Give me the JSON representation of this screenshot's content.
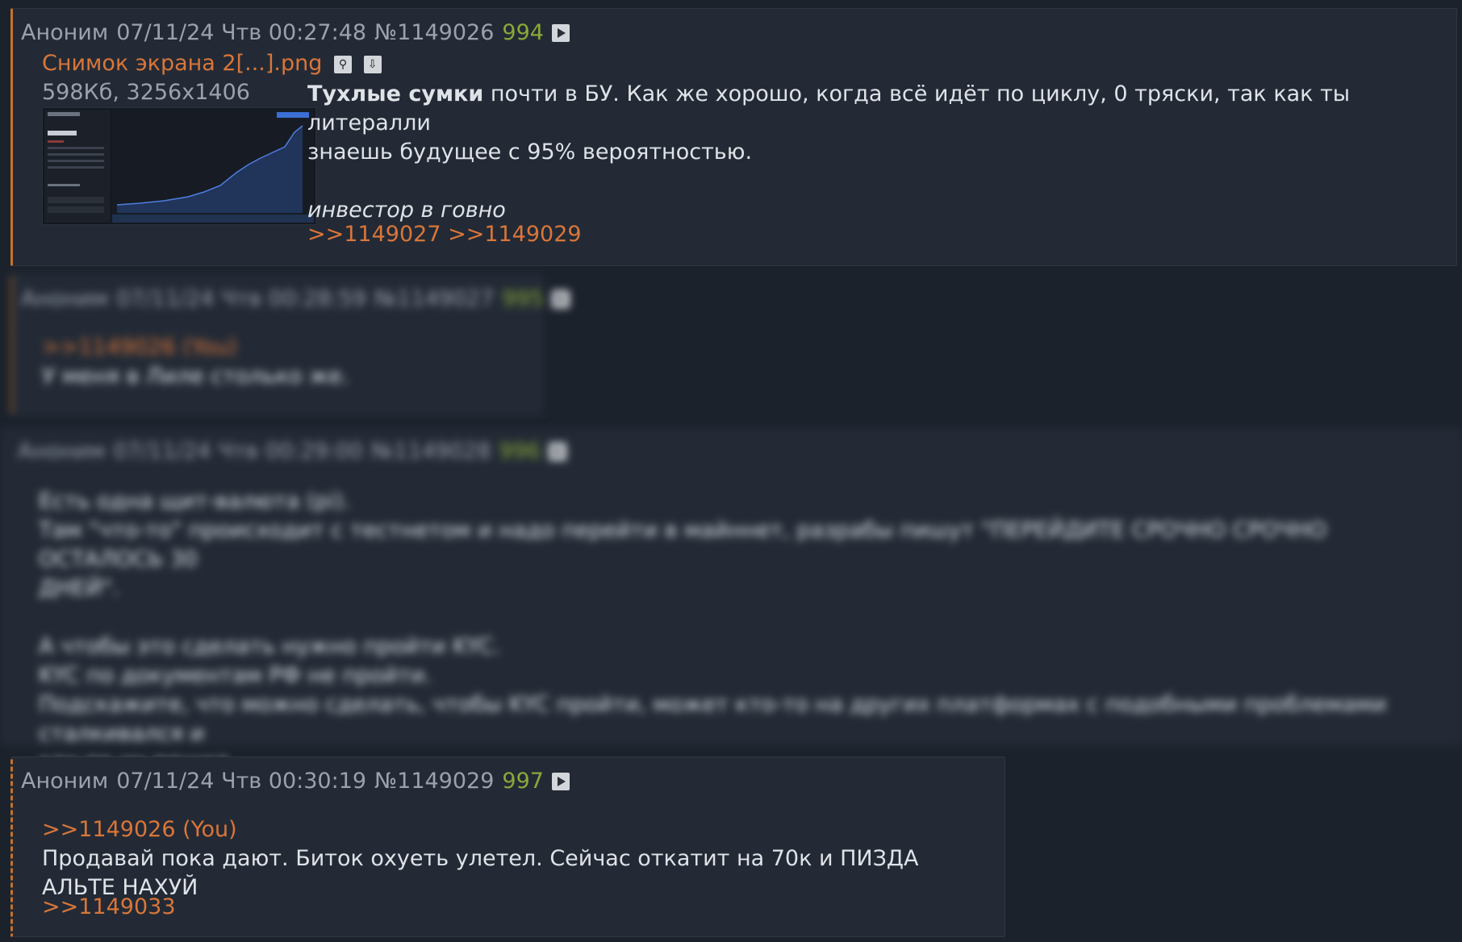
{
  "posts": [
    {
      "author": "Аноним",
      "date": "07/11/24 Чтв 00:27:48",
      "number": "№1149026",
      "count": "994",
      "file": {
        "name": "Снимок экрана 2[...].png",
        "meta": "598Кб, 3256x1406"
      },
      "text_bold": "Тухлые сумки",
      "text_rest": " почти в БУ. Как же хорошо, когда всё идёт по циклу, 0 тряски, так как ты литералли",
      "text_line2": "знаешь будущее с 95% вероятностью.",
      "italic": "инвестор в говно",
      "replies": ">>1149027 >>1149029"
    },
    {
      "author": "Аноним",
      "date": "07/11/24 Чтв 00:28:59",
      "number": "№1149027",
      "count": "995",
      "quote": ">>1149026 (You)",
      "text": "У меня в Лиле столько же."
    },
    {
      "author": "Аноним",
      "date": "07/11/24 Чтв 00:29:00",
      "number": "№1149028",
      "count": "996",
      "lines": [
        "Есть одна щит-валюта (pi).",
        "Там \"что-то\" происходит с тестнетом и надо перейти в майннет, разрабы пишут \"ПЕРЕЙДИТЕ СРОЧНО СРОЧНО ОСТАЛОСЬ 30",
        "ДНЕЙ\".",
        "",
        "А чтобы это сделать нужно пройти KYC.",
        "KYC по документам РФ не пройти.",
        "Подскажите, что можно сделать, чтобы KYC пройти, может кто-то на других платформах с подобными проблемами сталкивался и",
        "как-то их решил."
      ]
    },
    {
      "author": "Аноним",
      "date": "07/11/24 Чтв 00:30:19",
      "number": "№1149029",
      "count": "997",
      "quote": ">>1149026 (You)",
      "text": "Продавай пока дают. Биток охуеть улетел. Сейчас откатит на 70к и ПИЗДА АЛЬТЕ НАХУЙ",
      "replies": ">>1149033"
    }
  ],
  "colors": {
    "accent": "#c6722b",
    "count": "#8aa83a",
    "background": "#1c222c",
    "post_bg": "#232a35"
  }
}
